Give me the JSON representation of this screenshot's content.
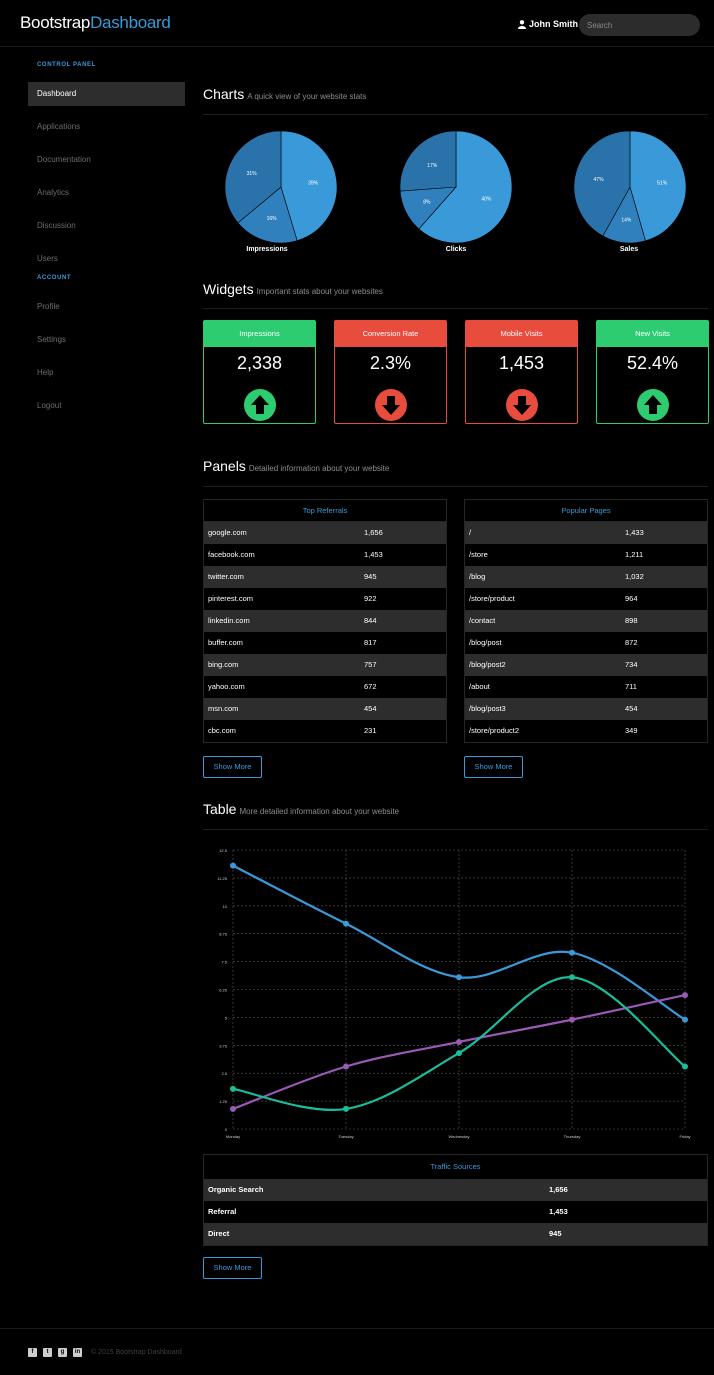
{
  "navbar": {
    "brand_part1": "Bootstrap",
    "brand_part2": "Dashboard",
    "user_name": "John Smith",
    "search_placeholder": "Search"
  },
  "sidebar": {
    "control_panel_heading": "CONTROL PANEL",
    "control_items": [
      {
        "label": "Dashboard",
        "active": true
      },
      {
        "label": "Applications"
      },
      {
        "label": "Documentation"
      },
      {
        "label": "Analytics"
      },
      {
        "label": "Discussion"
      },
      {
        "label": "Users"
      }
    ],
    "account_heading": "ACCOUNT",
    "account_items": [
      {
        "label": "Profile"
      },
      {
        "label": "Settings"
      },
      {
        "label": "Help"
      },
      {
        "label": "Logout"
      }
    ]
  },
  "sections": {
    "charts": {
      "title": "Charts",
      "subtitle": "A quick view of your website stats"
    },
    "widgets": {
      "title": "Widgets",
      "subtitle": "Important stats about your websites"
    },
    "panels": {
      "title": "Panels",
      "subtitle": "Detailed information about your website"
    },
    "table": {
      "title": "Table",
      "subtitle": "More detailed information about your website"
    }
  },
  "pies": [
    {
      "label": "Impressions",
      "slices": [
        39,
        16,
        31
      ]
    },
    {
      "label": "Clicks",
      "slices": [
        40,
        8,
        17
      ]
    },
    {
      "label": "Sales",
      "slices": [
        51,
        14,
        47
      ]
    }
  ],
  "widgets": [
    {
      "title": "Impressions",
      "value": "2,338",
      "trend": "up",
      "color": "#2ecc71"
    },
    {
      "title": "Conversion Rate",
      "value": "2.3%",
      "trend": "down",
      "color": "#e74c3c"
    },
    {
      "title": "Mobile Visits",
      "value": "1,453",
      "trend": "down",
      "color": "#e74c3c"
    },
    {
      "title": "New Visits",
      "value": "52.4%",
      "trend": "up",
      "color": "#2ecc71"
    }
  ],
  "panels": {
    "top_referrals": {
      "title": "Top Referrals",
      "rows": [
        [
          "google.com",
          "1,656"
        ],
        [
          "facebook.com",
          "1,453"
        ],
        [
          "twitter.com",
          "945"
        ],
        [
          "pinterest.com",
          "922"
        ],
        [
          "linkedin.com",
          "844"
        ],
        [
          "buffer.com",
          "817"
        ],
        [
          "bing.com",
          "757"
        ],
        [
          "yahoo.com",
          "672"
        ],
        [
          "msn.com",
          "454"
        ],
        [
          "cbc.com",
          "231"
        ]
      ]
    },
    "popular_pages": {
      "title": "Popular Pages",
      "rows": [
        [
          "/",
          "1,433"
        ],
        [
          "/store",
          "1,211"
        ],
        [
          "/blog",
          "1,032"
        ],
        [
          "/store/product",
          "964"
        ],
        [
          "/contact",
          "898"
        ],
        [
          "/blog/post",
          "872"
        ],
        [
          "/blog/post2",
          "734"
        ],
        [
          "/about",
          "711"
        ],
        [
          "/blog/post3",
          "454"
        ],
        [
          "/store/product2",
          "349"
        ]
      ]
    },
    "show_more_label": "Show More"
  },
  "chart_data": {
    "type": "line",
    "categories": [
      "Monday",
      "Tuesday",
      "Wednesday",
      "Thursday",
      "Friday"
    ],
    "ylim": [
      0,
      12.5
    ],
    "yticks": [
      "0",
      "1.25",
      "2.5",
      "3.75",
      "5",
      "6.25",
      "7.5",
      "8.75",
      "10",
      "11.25",
      "12.5"
    ],
    "series": [
      {
        "values": [
          11.8,
          9.2,
          6.8,
          7.9,
          4.9
        ],
        "color": "#3a9ad9"
      },
      {
        "values": [
          0.9,
          2.8,
          3.9,
          4.9,
          6.0
        ],
        "color": "#9b59b6"
      },
      {
        "values": [
          1.8,
          0.9,
          3.4,
          6.8,
          2.8
        ],
        "color": "#1abc9c"
      }
    ]
  },
  "traffic_sources": {
    "title": "Traffic Sources",
    "rows": [
      [
        "Organic Search",
        "1,656"
      ],
      [
        "Referral",
        "1,453"
      ],
      [
        "Direct",
        "945"
      ]
    ]
  },
  "footer": {
    "social_icons": [
      "facebook-icon",
      "twitter-icon",
      "google-plus-icon",
      "linkedin-icon"
    ],
    "copyright": "© 2015 Bootstrap Dashboard"
  }
}
